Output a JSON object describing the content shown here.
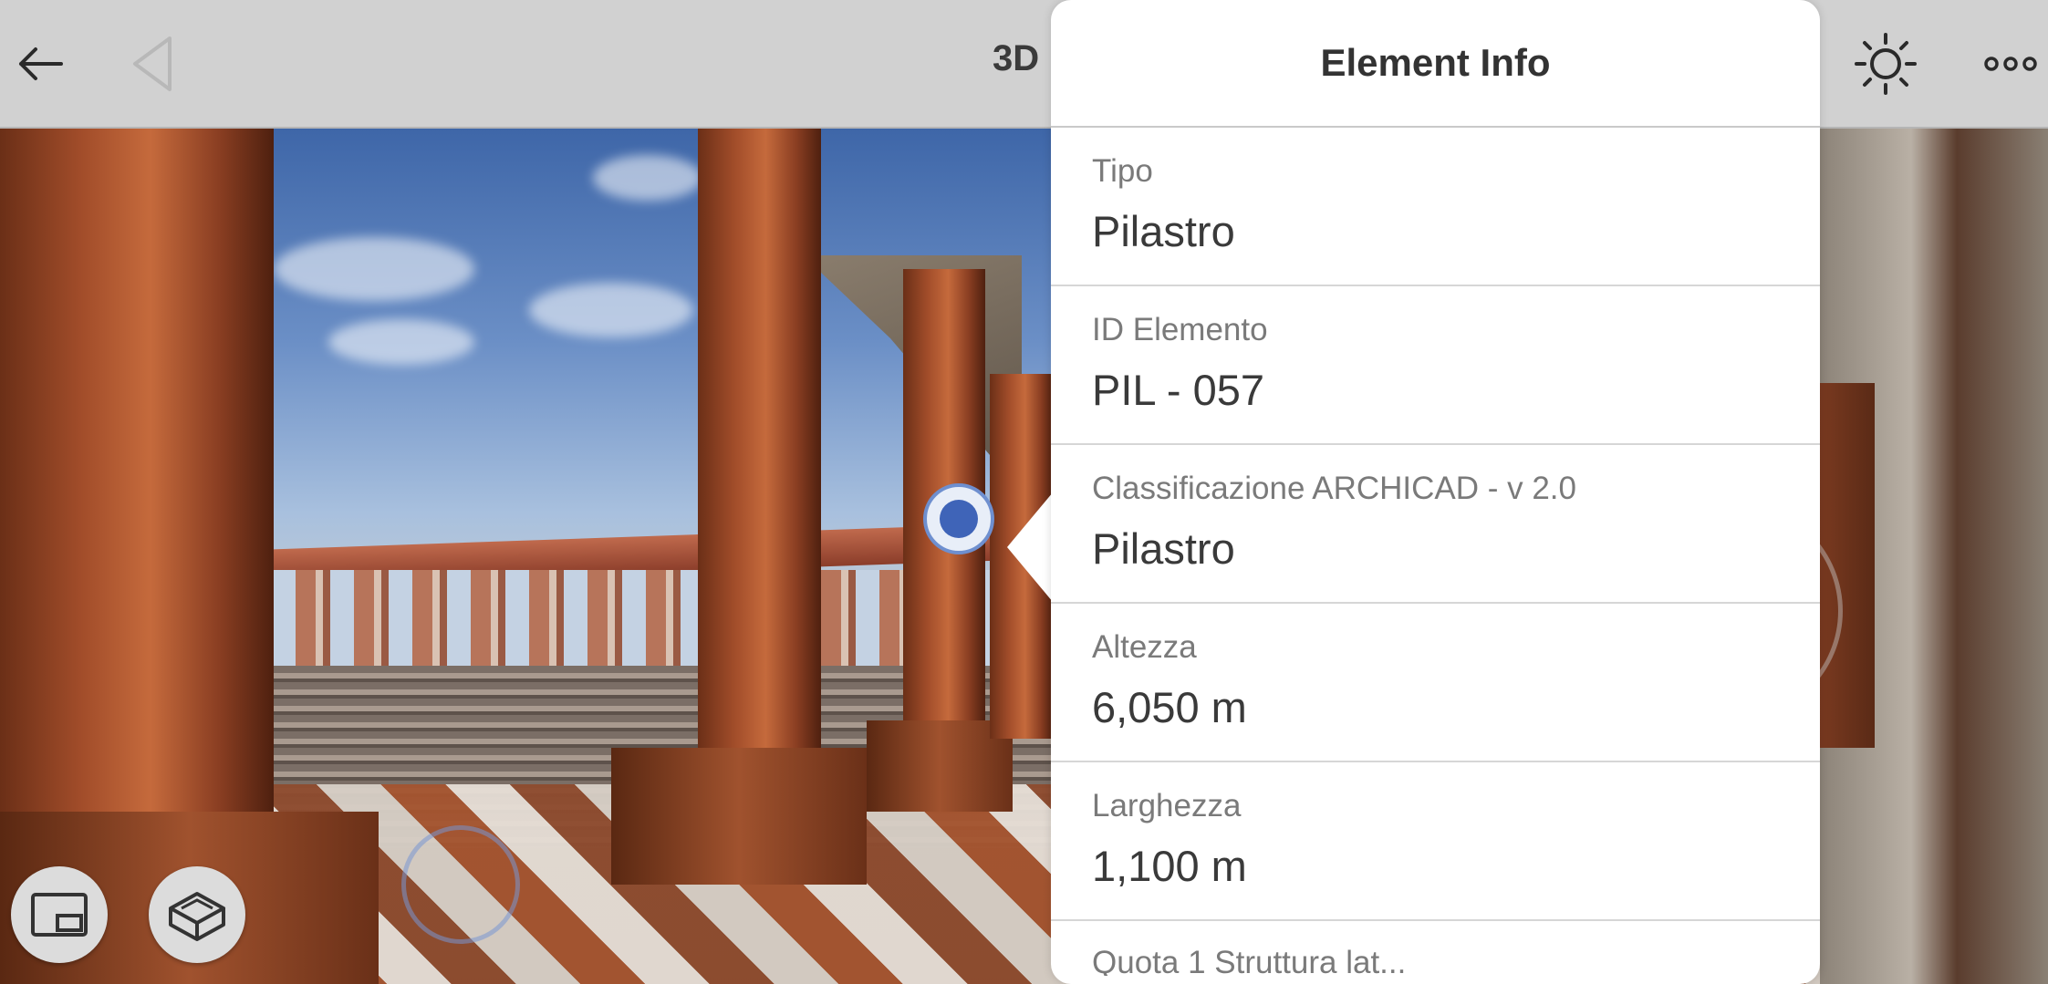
{
  "toolbar": {
    "title": "3D",
    "back_icon": "arrow-left-icon",
    "nav_icon": "triangle-left-icon",
    "sun_icon": "sun-icon",
    "more_icon": "more-horizontal-icon"
  },
  "element_info": {
    "title": "Element Info",
    "rows": [
      {
        "label": "Tipo",
        "value": "Pilastro"
      },
      {
        "label": "ID Elemento",
        "value": "PIL - 057"
      },
      {
        "label": "Classificazione ARCHICAD - v 2.0",
        "value": "Pilastro"
      },
      {
        "label": "Altezza",
        "value": "6,050 m"
      },
      {
        "label": "Larghezza",
        "value": "1,100 m"
      },
      {
        "label": "Quota 1 Struttura lat...",
        "value": ""
      }
    ]
  },
  "controls": {
    "view_toggle_icon": "picture-in-picture-icon",
    "model_icon": "3d-box-icon"
  },
  "colors": {
    "toolbar": "#d1d1d1",
    "pin": "#3f64b8",
    "popover": "#ffffff"
  }
}
